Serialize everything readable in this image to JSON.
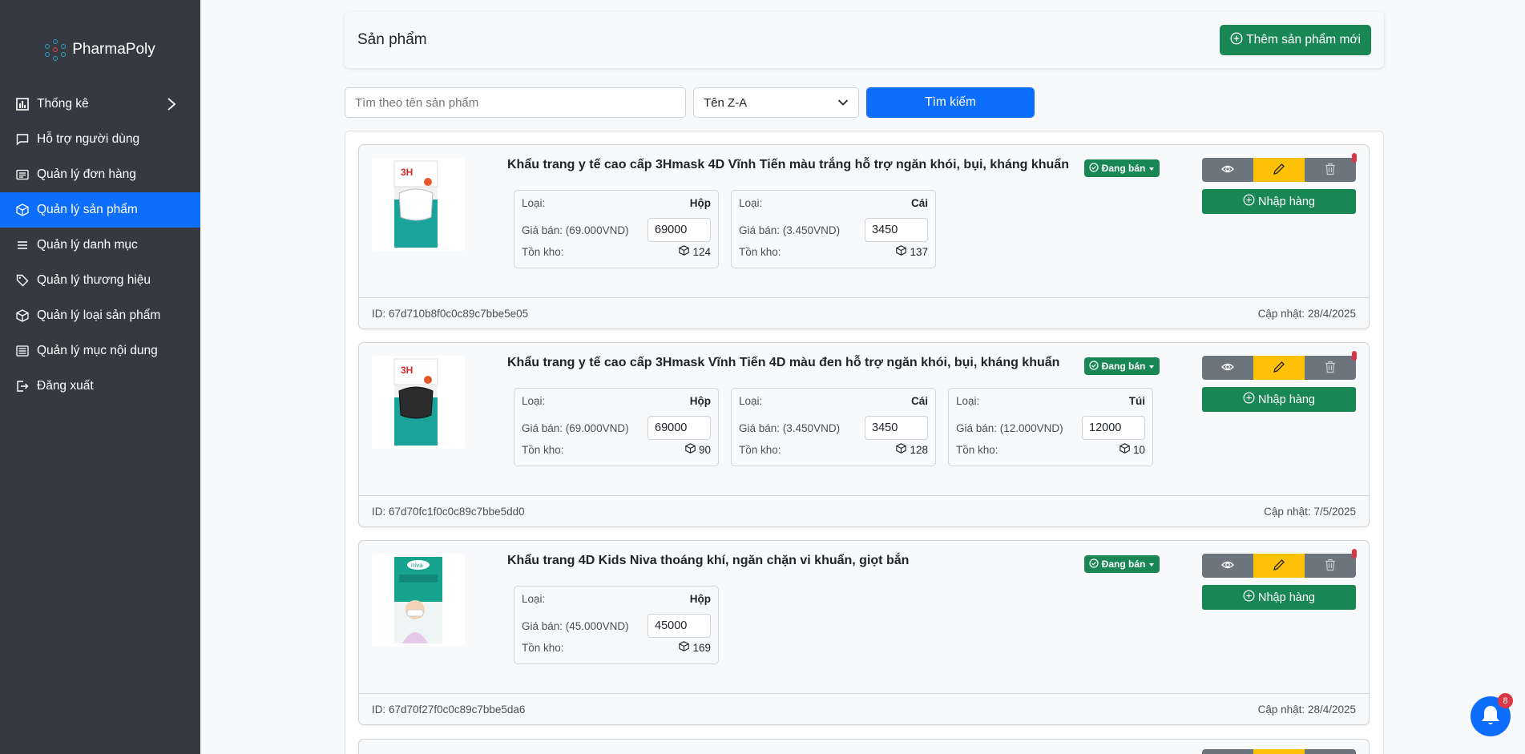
{
  "brand": {
    "name": "PharmaPoly"
  },
  "sidebar": {
    "items": [
      {
        "label": "Thống kê",
        "icon": "chart-icon"
      },
      {
        "label": "Hỗ trợ người dùng",
        "icon": "chat-icon"
      },
      {
        "label": "Quản lý đơn hàng",
        "icon": "list-card-icon"
      },
      {
        "label": "Quản lý sản phẩm",
        "icon": "box-icon"
      },
      {
        "label": "Quản lý danh mục",
        "icon": "menu-icon"
      },
      {
        "label": "Quản lý thương hiệu",
        "icon": "tags-icon"
      },
      {
        "label": "Quản lý loại sản phẩm",
        "icon": "box-icon"
      },
      {
        "label": "Quản lý mục nội dung",
        "icon": "newspaper-icon"
      },
      {
        "label": "Đăng xuất",
        "icon": "logout-icon"
      }
    ]
  },
  "header": {
    "title": "Sản phẩm",
    "add_label": "Thêm sản phẩm mới"
  },
  "search": {
    "placeholder": "Tìm theo tên sản phẩm",
    "sort_value": "Tên Z-A",
    "button_label": "Tìm kiếm"
  },
  "labels": {
    "type": "Loại:",
    "stock": "Tồn kho:",
    "status": "Đang bán",
    "import": "Nhập hàng",
    "id_prefix": "ID: ",
    "updated_prefix": "Cập nhật: "
  },
  "products": [
    {
      "name": "Khẩu trang y tế cao cấp 3Hmask 4D Vĩnh Tiến màu trắng hỗ trợ ngăn khói, bụi, kháng khuẩn",
      "id": "67d710b8f0c0c89c7bbe5e05",
      "updated": "28/4/2025",
      "variants": [
        {
          "unit": "Hộp",
          "price_label": "Giá bán: (69.000VND)",
          "price": "69000",
          "stock": "124"
        },
        {
          "unit": "Cái",
          "price_label": "Giá bán: (3.450VND)",
          "price": "3450",
          "stock": "137"
        }
      ]
    },
    {
      "name": "Khẩu trang y tế cao cấp 3Hmask Vĩnh Tiến 4D màu đen hỗ trợ ngăn khói, bụi, kháng khuẩn",
      "id": "67d70fc1f0c0c89c7bbe5dd0",
      "updated": "7/5/2025",
      "variants": [
        {
          "unit": "Hộp",
          "price_label": "Giá bán: (69.000VND)",
          "price": "69000",
          "stock": "90"
        },
        {
          "unit": "Cái",
          "price_label": "Giá bán: (3.450VND)",
          "price": "3450",
          "stock": "128"
        },
        {
          "unit": "Túi",
          "price_label": "Giá bán: (12.000VND)",
          "price": "12000",
          "stock": "10"
        }
      ]
    },
    {
      "name": "Khẩu trang 4D Kids Niva thoáng khí, ngăn chặn vi khuẩn, giọt bắn",
      "id": "67d70f27f0c0c89c7bbe5da6",
      "updated": "28/4/2025",
      "variants": [
        {
          "unit": "Hộp",
          "price_label": "Giá bán: (45.000VND)",
          "price": "45000",
          "stock": "169"
        }
      ]
    }
  ],
  "notifications": {
    "count": "8"
  },
  "colors": {
    "sidebar": "#343a40",
    "primary": "#0d6efd",
    "success": "#198754",
    "warning": "#ffc107",
    "secondary": "#6c757d"
  }
}
